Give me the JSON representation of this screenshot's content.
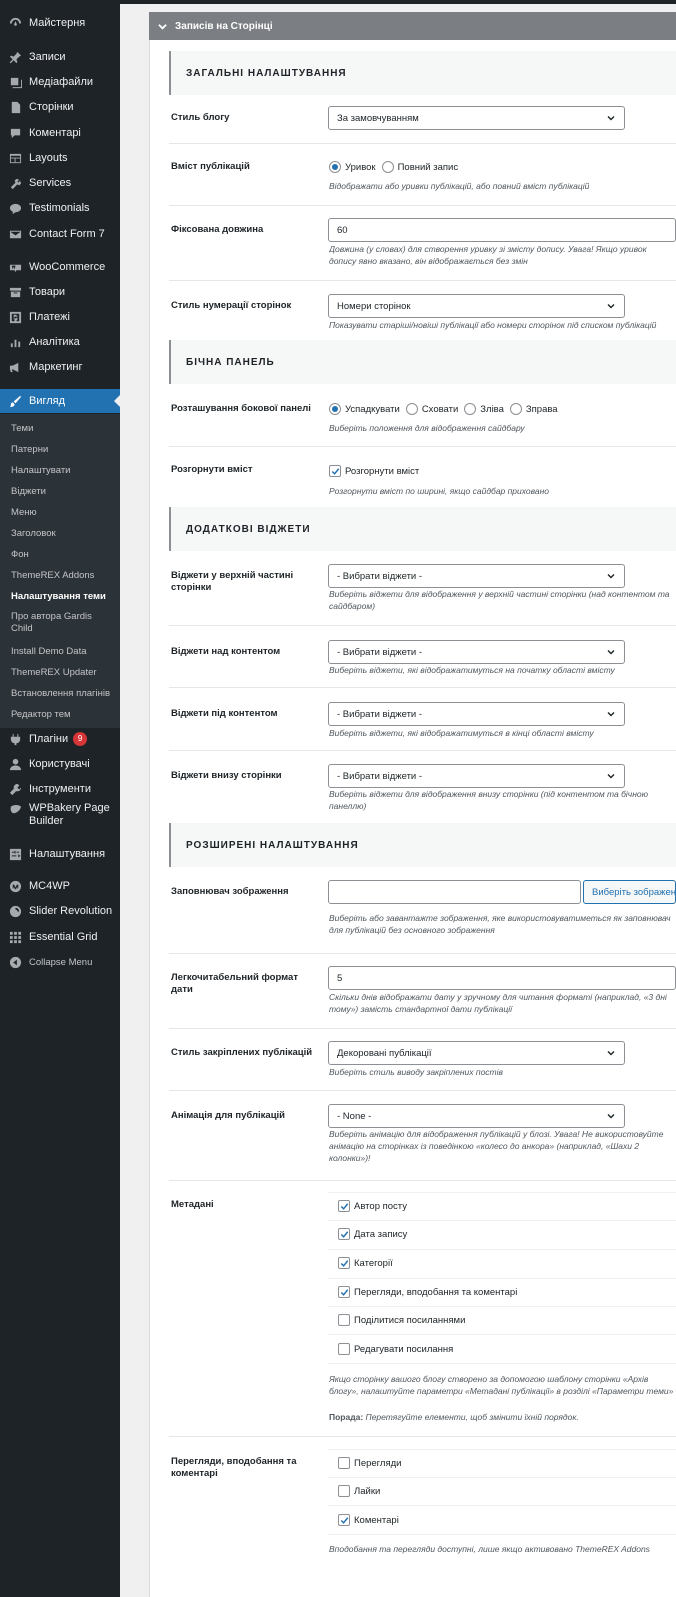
{
  "sidebar": {
    "items": [
      {
        "label": "Майстерня",
        "icon": "dashboard-icon"
      },
      {
        "label": "Записи",
        "icon": "pin-icon"
      },
      {
        "label": "Медіафайли",
        "icon": "media-icon"
      },
      {
        "label": "Сторінки",
        "icon": "page-icon"
      },
      {
        "label": "Коментарі",
        "icon": "comment-icon"
      },
      {
        "label": "Layouts",
        "icon": "layouts-icon"
      },
      {
        "label": "Services",
        "icon": "tools-icon"
      },
      {
        "label": "Testimonials",
        "icon": "testimonial-icon"
      },
      {
        "label": "Contact Form 7",
        "icon": "mail-icon"
      },
      {
        "label": "WooCommerce",
        "icon": "woo-icon"
      },
      {
        "label": "Товари",
        "icon": "archive-icon"
      },
      {
        "label": "Платежі",
        "icon": "payment-icon"
      },
      {
        "label": "Аналітика",
        "icon": "chart-icon"
      },
      {
        "label": "Маркетинг",
        "icon": "megaphone-icon"
      },
      {
        "label": "Вигляд",
        "icon": "brush-icon"
      },
      {
        "label": "Плагіни",
        "icon": "plugin-icon",
        "badge": "9"
      },
      {
        "label": "Користувачі",
        "icon": "users-icon"
      },
      {
        "label": "Інструменти",
        "icon": "wrench-icon"
      },
      {
        "label": "WPBakery Page Builder",
        "icon": "wpbakery-icon"
      },
      {
        "label": "Налаштування",
        "icon": "settings-icon"
      },
      {
        "label": "MC4WP",
        "icon": "mc4wp-icon"
      },
      {
        "label": "Slider Revolution",
        "icon": "slider-icon"
      },
      {
        "label": "Essential Grid",
        "icon": "grid-icon"
      },
      {
        "label": "Collapse Menu",
        "icon": "collapse-icon"
      }
    ],
    "submenu": [
      "Теми",
      "Патерни",
      "Налаштувати",
      "Віджети",
      "Меню",
      "Заголовок",
      "Фон",
      "ThemeREX Addons",
      "Налаштування теми",
      "Про автора Gardis Child",
      "Install Demo Data",
      "ThemeREX Updater",
      "Встановлення плагінів",
      "Редактор тем"
    ]
  },
  "panel": {
    "title": "Записів на Сторінці"
  },
  "sections": {
    "general": "ЗАГАЛЬНІ НАЛАШТУВАННЯ",
    "sidebar": "БІЧНА ПАНЕЛЬ",
    "widgets": "ДОДАТКОВІ ВІДЖЕТИ",
    "advanced": "РОЗШИРЕНІ НАЛАШТУВАННЯ"
  },
  "fields": {
    "blog_style": {
      "label": "Стиль блогу",
      "value": "За замовчуванням"
    },
    "post_content": {
      "label": "Вміст публікацій",
      "options": [
        "Уривок",
        "Повний запис"
      ],
      "desc": "Відображати або уривки публікацій, або повний вміст публікацій"
    },
    "fixed_length": {
      "label": "Фіксована довжина",
      "value": "60",
      "desc": "Довжина (у словах) для створення уривку зі змісту допису. Увага! Якщо уривок допису явно вказано, він відображається без змін"
    },
    "pagination": {
      "label": "Стиль нумерації сторінок",
      "value": "Номери сторінок",
      "desc": "Показувати старіші/новіші публікації або номери сторінок під списком публікацій"
    },
    "sidebar_position": {
      "label": "Розташування бокової панелі",
      "options": [
        "Успадкувати",
        "Сховати",
        "Зліва",
        "Зправа"
      ],
      "desc": "Виберіть положення для відображення сайдбару"
    },
    "expand_content": {
      "label": "Розгорнути вміст",
      "checkbox": "Розгорнути вміст",
      "desc": "Розгорнути вміст по ширині, якщо сайдбар приховано"
    },
    "widgets_top": {
      "label": "Віджети у верхній частині сторінки",
      "value": "- Вибрати віджети -",
      "desc": "Виберіть віджети для відображення у верхній частині сторінки (над контентом та сайдбаром)"
    },
    "widgets_above": {
      "label": "Віджети над контентом",
      "value": "- Вибрати віджети -",
      "desc": "Виберіть віджети, які відображатимуться на початку області вмісту"
    },
    "widgets_below": {
      "label": "Віджети під контентом",
      "value": "- Вибрати віджети -",
      "desc": "Виберіть віджети, які відображатимуться в кінці області вмісту"
    },
    "widgets_bottom": {
      "label": "Віджети внизу сторінки",
      "value": "- Вибрати віджети -",
      "desc": "Виберіть віджети для відображення внизу сторінки (під контентом та бічною панеллю)"
    },
    "placeholder_image": {
      "label": "Заповнювач зображення",
      "value": "",
      "button": "Виберіть зображення",
      "desc": "Виберіть або завантажте зображення, яке використовуватиметься як заповнювач для публікацій без основного зображення"
    },
    "date_format": {
      "label": "Легкочитабельний формат дати",
      "value": "5",
      "desc": "Скільки днів відображати дату у зручному для читання форматі (наприклад, «3 дні тому») замість стандартної дати публікації"
    },
    "sticky_style": {
      "label": "Стиль закріплених публікацій",
      "value": "Декоровані публікації",
      "desc": "Виберіть стиль виводу закріплених постів"
    },
    "animation": {
      "label": "Анімація для публікацій",
      "value": "- None -",
      "desc": "Виберіть анімацію для відображення публікацій у блозі. Увага! Не використовуйте анімацію на сторінках із поведінкою «колесо до анкора» (наприклад, «Шахи 2 колонки»)!"
    },
    "meta": {
      "label": "Метадані",
      "items": [
        {
          "label": "Автор посту",
          "checked": true
        },
        {
          "label": "Дата запису",
          "checked": true
        },
        {
          "label": "Категорії",
          "checked": true
        },
        {
          "label": "Перегляди, вподобання та коментарі",
          "checked": true
        },
        {
          "label": "Поділитися посиланнями",
          "checked": false
        },
        {
          "label": "Редагувати посилання",
          "checked": false
        }
      ],
      "desc": "Якщо сторінку вашого блогу створено за допомогою шаблону сторінки «Архів блогу», налаштуйте параметри «Метадані публікації» в розділі «Параметри теми» цієї сторінки.",
      "tip_bold": "Порада:",
      "tip": " Перетягуйте елементи, щоб змінити їхній порядок."
    },
    "counters": {
      "label": "Перегляди, вподобання та коментарі",
      "items": [
        {
          "label": "Перегляди",
          "checked": false
        },
        {
          "label": "Лайки",
          "checked": false
        },
        {
          "label": "Коментарі",
          "checked": true
        }
      ],
      "desc": "Вподобання та перегляди доступні, лише якщо активовано ThemeREX Addons"
    }
  },
  "colors": {
    "accent": "#2271b1",
    "sidebar_bg": "#1d2327",
    "panel_head": "#7b7e82"
  }
}
